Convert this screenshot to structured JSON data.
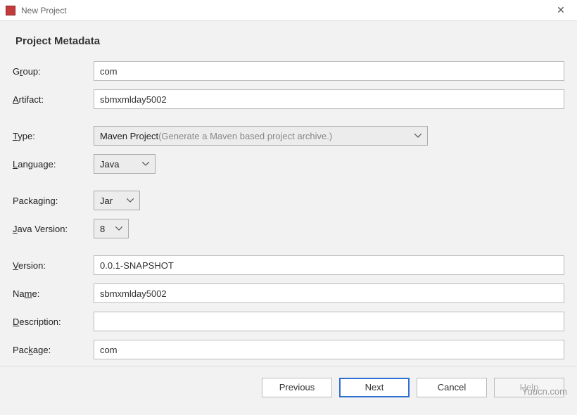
{
  "window": {
    "title": "New Project"
  },
  "heading": "Project Metadata",
  "fields": {
    "group": {
      "label_pre": "G",
      "label_ul": "r",
      "label_post": "oup:",
      "value": "com"
    },
    "artifact": {
      "label_pre": "",
      "label_ul": "A",
      "label_post": "rtifact:",
      "value": "sbmxmlday5002"
    },
    "type": {
      "label_pre": "",
      "label_ul": "T",
      "label_post": "ype:",
      "value": "Maven Project",
      "hint": " (Generate a Maven based project archive.)"
    },
    "language": {
      "label_pre": "",
      "label_ul": "L",
      "label_post": "anguage:",
      "value": "Java"
    },
    "packaging": {
      "label_pre": "Packaging:",
      "value": "Jar"
    },
    "java_version": {
      "label_pre": "",
      "label_ul": "J",
      "label_post": "ava Version:",
      "value": "8"
    },
    "version": {
      "label_pre": "",
      "label_ul": "V",
      "label_post": "ersion:",
      "value": "0.0.1-SNAPSHOT"
    },
    "name": {
      "label_pre": "Na",
      "label_ul": "m",
      "label_post": "e:",
      "value": "sbmxmlday5002"
    },
    "description": {
      "label_pre": "",
      "label_ul": "D",
      "label_post": "escription:",
      "value": ""
    },
    "package": {
      "label_pre": "Pac",
      "label_ul": "k",
      "label_post": "age:",
      "value": "com"
    }
  },
  "buttons": {
    "previous": "Previous",
    "next": "Next",
    "cancel": "Cancel",
    "help": "Help"
  },
  "watermark": "Yuucn.com"
}
